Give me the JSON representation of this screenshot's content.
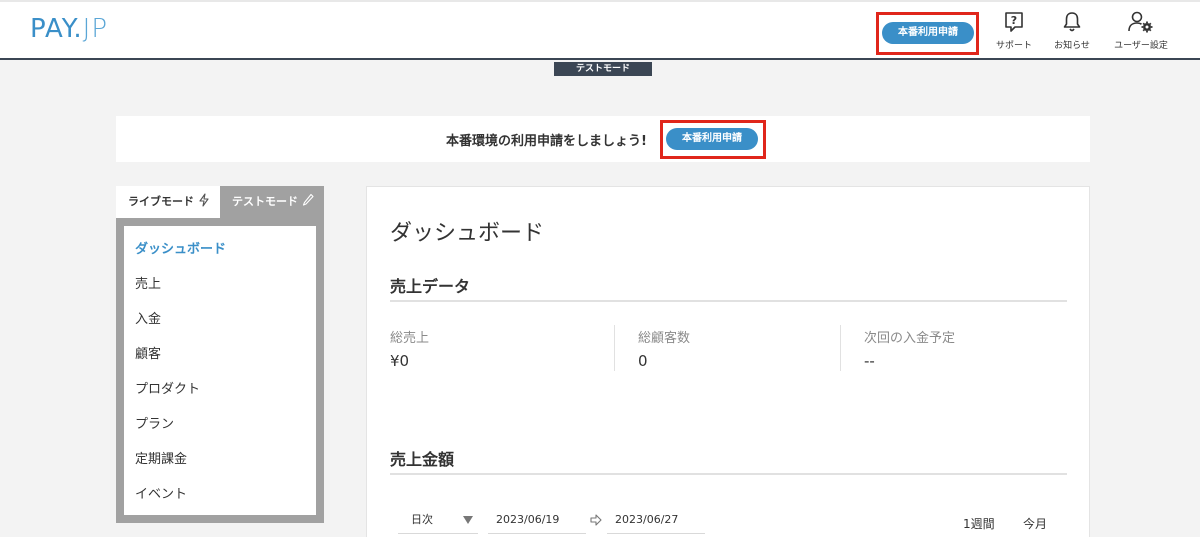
{
  "header": {
    "logo_main": "PAY",
    "logo_dot": ".",
    "logo_sub": "JP",
    "apply_label": "本番利用申請",
    "nav": [
      {
        "label": "サポート",
        "icon": "help-icon"
      },
      {
        "label": "お知らせ",
        "icon": "bell-icon"
      },
      {
        "label": "ユーザー設定",
        "icon": "user-gear-icon"
      }
    ]
  },
  "mode_tag": "テストモード",
  "banner": {
    "text": "本番環境の利用申請をしましょう!",
    "button_label": "本番利用申請"
  },
  "sidebar": {
    "tabs": [
      {
        "label": "ライブモード",
        "icon": "lightning-icon"
      },
      {
        "label": "テストモード",
        "icon": "pencil-icon"
      }
    ],
    "items": [
      {
        "label": "ダッシュボード",
        "active": true
      },
      {
        "label": "売上"
      },
      {
        "label": "入金"
      },
      {
        "label": "顧客"
      },
      {
        "label": "プロダクト"
      },
      {
        "label": "プラン"
      },
      {
        "label": "定期課金"
      },
      {
        "label": "イベント"
      }
    ]
  },
  "main": {
    "title": "ダッシュボード",
    "sales_data": {
      "title": "売上データ",
      "stats": [
        {
          "label": "総売上",
          "value": "¥0"
        },
        {
          "label": "総顧客数",
          "value": "0"
        },
        {
          "label": "次回の入金予定",
          "value": "--"
        }
      ]
    },
    "sales_amount": {
      "title": "売上金額",
      "interval": "日次",
      "start_date": "2023/06/19",
      "end_date": "2023/06/27",
      "ranges": [
        "1週間",
        "今月"
      ]
    }
  },
  "colors": {
    "accent": "#3a8fc8",
    "highlight": "#e0261b",
    "header_line": "#3b4654",
    "tab_inactive": "#a1a1a1"
  }
}
